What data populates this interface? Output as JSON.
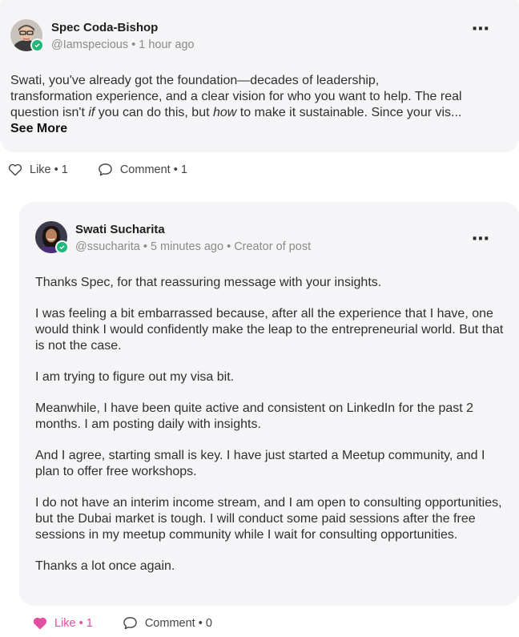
{
  "comment": {
    "author": "Spec Coda-Bishop",
    "handle": "@Iamspecious",
    "time": "1 hour ago",
    "text_line1": "Swati, you've already got the foundation—decades of leadership,",
    "text_line2": "transformation experience, and a clear vision for who you want to help. The real",
    "text_line3_a": "question isn't ",
    "text_line3_em1": "if",
    "text_line3_b": " you can do this, but ",
    "text_line3_em2": "how",
    "text_line3_c": " to make it sustainable. Since your vis...",
    "see_more": "See More",
    "like_label": "Like",
    "like_count": "1",
    "comment_label": "Comment",
    "comment_count": "1",
    "more_menu": "⋯"
  },
  "reply": {
    "author": "Swati Sucharita",
    "handle": "@ssucharita",
    "time": "5 minutes ago",
    "creator_tag": "Creator of post",
    "paragraphs": [
      "Thanks Spec, for that reassuring message with your insights.",
      "I was feeling a bit embarrassed because, after all the experience that I have, one would think I would confidently make the leap to the entrepreneurial world. But that is not the case.",
      "I am trying to figure out my visa bit.",
      "Meanwhile, I have been quite active and consistent on LinkedIn for the past 2 months. I am posting daily with insights.",
      "And I agree, starting small is key. I have just started a Meetup community, and I plan to offer free workshops.",
      "I do not have an interim income stream, and I am open to consulting opportunities, but the Dubai market is tough. I will conduct some paid sessions after the free sessions in my meetup community while I wait for consulting opportunities.",
      "Thanks a lot once again."
    ],
    "like_label": "Like",
    "like_count": "1",
    "comment_label": "Comment",
    "comment_count": "0",
    "more_menu": "⋯"
  },
  "colors": {
    "card_bg": "#f5f5f7",
    "verified": "#20b87a",
    "liked": "#e24fa0",
    "meta": "#8a8a8a"
  }
}
